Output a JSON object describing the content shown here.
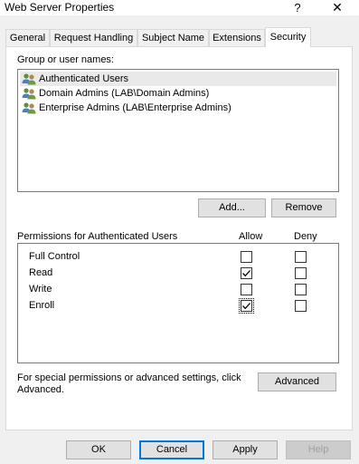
{
  "window": {
    "title": "Web Server Properties",
    "help_glyph": "?",
    "close_glyph": "✕"
  },
  "tabs": [
    {
      "label": "General"
    },
    {
      "label": "Request Handling"
    },
    {
      "label": "Subject Name"
    },
    {
      "label": "Extensions"
    },
    {
      "label": "Security",
      "active": true
    }
  ],
  "group_section": {
    "label": "Group or user names:",
    "items": [
      {
        "name": "Authenticated Users",
        "icon": "users-icon",
        "selected": true
      },
      {
        "name": "Domain Admins (LAB\\Domain Admins)",
        "icon": "users-icon"
      },
      {
        "name": "Enterprise Admins (LAB\\Enterprise Admins)",
        "icon": "users-icon"
      }
    ],
    "add_label": "Add...",
    "remove_label": "Remove"
  },
  "permissions": {
    "header": "Permissions for Authenticated Users",
    "allow_label": "Allow",
    "deny_label": "Deny",
    "rows": [
      {
        "name": "Full Control",
        "allow": false,
        "deny": false
      },
      {
        "name": "Read",
        "allow": true,
        "deny": false
      },
      {
        "name": "Write",
        "allow": false,
        "deny": false
      },
      {
        "name": "Enroll",
        "allow": true,
        "deny": false
      }
    ]
  },
  "advanced": {
    "text_line1": "For special permissions or advanced settings, click",
    "text_line2": "Advanced.",
    "button_label": "Advanced"
  },
  "footer": {
    "ok_label": "OK",
    "cancel_label": "Cancel",
    "apply_label": "Apply",
    "help_label": "Help"
  }
}
